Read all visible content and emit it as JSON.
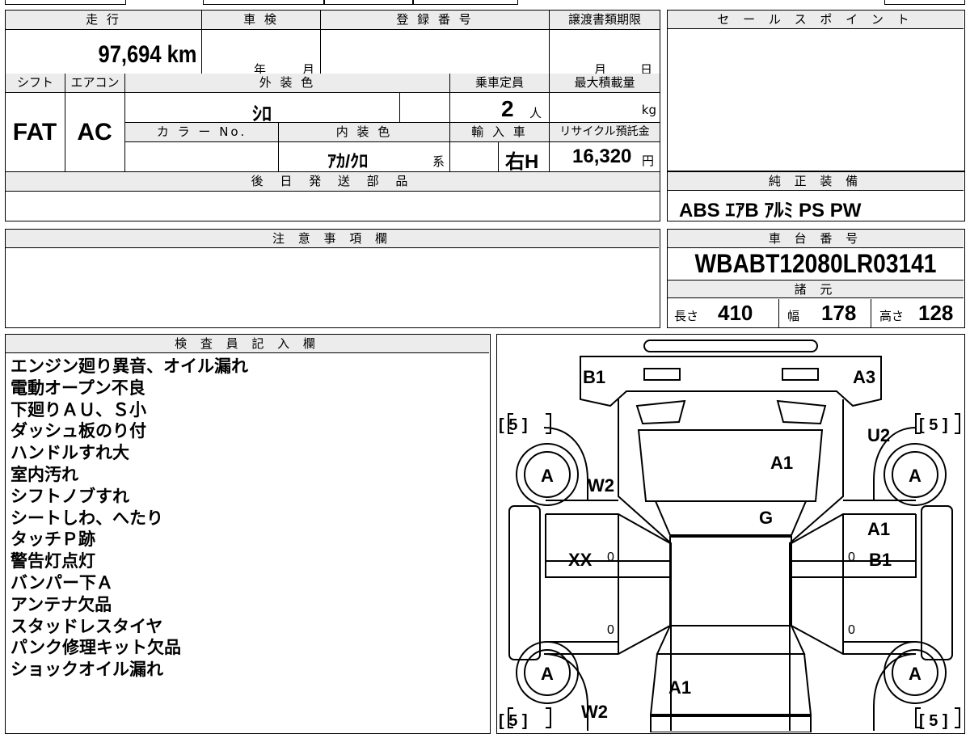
{
  "vehicle": {
    "mileage_label": "走 行",
    "mileage_value": "97,694 km",
    "inspection_label": "車 検",
    "inspection_year_unit": "年",
    "inspection_month_unit": "月",
    "registration_label": "登 録 番 号",
    "transfer_label": "譲渡書類期限",
    "transfer_month_unit": "月",
    "transfer_day_unit": "日",
    "shift_label": "シフト",
    "shift_value": "FAT",
    "aircon_label": "エアコン",
    "aircon_value": "AC",
    "exterior_color_label": "外 装 色",
    "exterior_color_value": "ｼﾛ",
    "capacity_label": "乗車定員",
    "capacity_value": "2",
    "capacity_unit": "人",
    "max_load_label": "最大積載量",
    "max_load_unit": "kg",
    "color_no_label": "カ ラ ー No.",
    "interior_color_label": "内 装 色",
    "interior_color_value": "ｱｶ/ｸﾛ",
    "interior_suffix": "系",
    "import_label": "輸 入 車",
    "import_value": "右H",
    "recycle_label": "リサイクル預託金",
    "recycle_value": "16,320",
    "recycle_unit": "円",
    "later_parts_label": "後 日 発 送 部 品"
  },
  "sales_point_label": "セ ー ル ス ポ イ ン ト",
  "genuine_equipment": {
    "label": "純 正 装 備",
    "value": "ABS ｴｱB ｱﾙﾐ PS PW"
  },
  "notes_label": "注 意 事 項 欄",
  "chassis": {
    "label": "車 台 番 号",
    "value": "WBABT12080LR03141",
    "specs_label": "諸 元",
    "length_label": "長さ",
    "length_value": "410",
    "width_label": "幅",
    "width_value": "178",
    "height_label": "高さ",
    "height_value": "128"
  },
  "inspector": {
    "label": "検 査 員 記 入 欄",
    "notes": [
      "エンジン廻り異音、オイル漏れ",
      "電動オープン不良",
      "下廻りＡＵ、Ｓ小",
      "ダッシュ板のり付",
      "ハンドルすれ大",
      "室内汚れ",
      "シフトノブすれ",
      "シートしわ、へたり",
      "タッチＰ跡",
      "警告灯点灯",
      "バンパー下Ａ",
      "アンテナ欠品",
      "スタッドレスタイヤ",
      "パンク修理キット欠品",
      "ショックオイル漏れ"
    ]
  },
  "diagram": {
    "tire_grade": "[ 5 ]",
    "wheel_grade": "A",
    "marks": {
      "front_left": "B1",
      "front_right": "A3",
      "hood": "A1",
      "windshield": "G",
      "left_fender": "W2",
      "right_fender": "U2",
      "left_door": "XX",
      "right_door_upper": "A1",
      "right_door_lower": "B1",
      "trunk": "A1",
      "rear_left": "W2",
      "zero": "0"
    }
  }
}
